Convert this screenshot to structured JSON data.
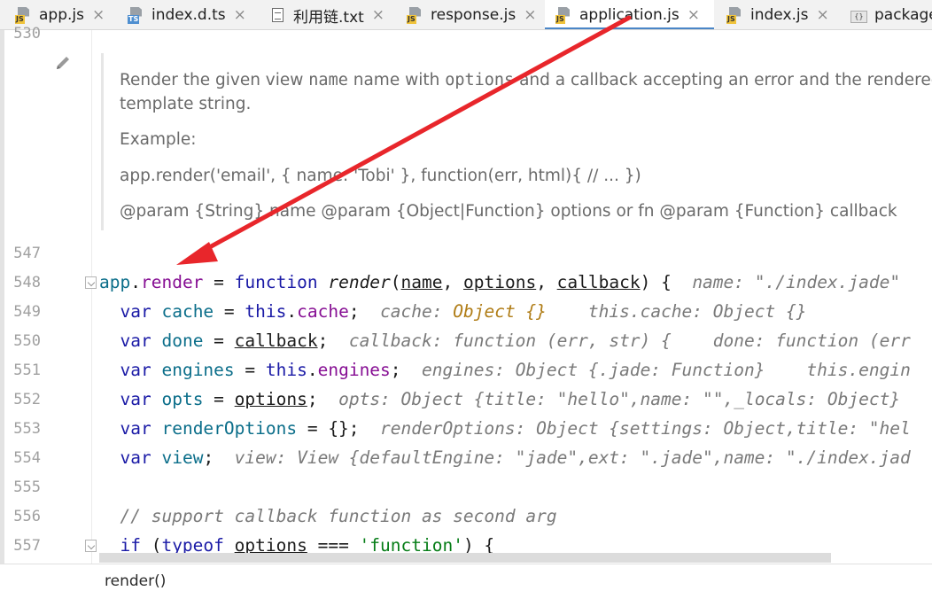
{
  "tabs": [
    {
      "label": "app.js",
      "icon": "js-file-icon",
      "type": "js",
      "active": false
    },
    {
      "label": "index.d.ts",
      "icon": "ts-file-icon",
      "type": "ts",
      "active": false
    },
    {
      "label": "利用链.txt",
      "icon": "text-file-icon",
      "type": "txt",
      "active": false
    },
    {
      "label": "response.js",
      "icon": "js-file-icon",
      "type": "js",
      "active": false
    },
    {
      "label": "application.js",
      "icon": "js-file-icon",
      "type": "js",
      "active": true
    },
    {
      "label": "index.js",
      "icon": "js-file-icon",
      "type": "js",
      "active": false
    },
    {
      "label": "package",
      "icon": "json-file-icon",
      "type": "json",
      "active": false
    }
  ],
  "tab_close_glyph": "×",
  "gutter": {
    "doc_line_number": "530",
    "line_numbers": [
      "547",
      "548",
      "549",
      "550",
      "551",
      "552",
      "553",
      "554",
      "555",
      "556",
      "557"
    ]
  },
  "doc": {
    "line1a": "Render the given view ",
    "line1_name": "name",
    "line1b": " name with ",
    "line1_options": "options",
    "line1c": " and a callback accepting an error and the rendered",
    "line2": "template string.",
    "example_label": "Example:",
    "example_code": "app.render('email', { name: 'Tobi' }, function(err, html){ // ... })",
    "params": "@param {String} name @param {Object|Function} options or fn @param {Function} callback"
  },
  "code": {
    "l548": {
      "obj": "app",
      "dot": ".",
      "prop": "render",
      "eq": " = ",
      "kw": "function",
      "sp": " ",
      "fname": "render",
      "open": "(",
      "p1": "name",
      "c1": ", ",
      "p2": "options",
      "c2": ", ",
      "p3": "callback",
      "close": ") {",
      "hint": "name: \"./index.jade\" "
    },
    "l549": {
      "kw": "var",
      "name": "cache",
      "eq": " = ",
      "this": "this",
      "dot": ".",
      "prop": "cache",
      "semi": ";",
      "hint1": "cache: ",
      "hint1_val": "Object {}",
      "hint2": "this.cache: Object {}"
    },
    "l550": {
      "kw": "var",
      "name": "done",
      "eq": " = ",
      "rhs": "callback",
      "semi": ";",
      "hint1": "callback: function (err, str) {",
      "hint2": "done: function (err"
    },
    "l551": {
      "kw": "var",
      "name": "engines",
      "eq": " = ",
      "this": "this",
      "dot": ".",
      "prop": "engines",
      "semi": ";",
      "hint1": "engines: Object {.jade: Function}",
      "hint2": "this.engin"
    },
    "l552": {
      "kw": "var",
      "name": "opts",
      "eq": " = ",
      "rhs": "options",
      "semi": ";",
      "hint1": "opts: Object {title: \"hello\",name: \"\",_locals: Object}"
    },
    "l553": {
      "kw": "var",
      "name": "renderOptions",
      "rest": " = {};",
      "hint1": "renderOptions: Object {settings: Object,title: \"hel"
    },
    "l554": {
      "kw": "var",
      "name": "view",
      "semi": ";",
      "hint1": "view: View {defaultEngine: \"jade\",ext: \".jade\",name: \"./index.jad"
    },
    "l556": {
      "comment": "// support callback function as second arg"
    },
    "l557": {
      "kw": "if",
      "open": " (",
      "kw2": "typeof",
      "sp": " ",
      "param": "options",
      "op": " === ",
      "str": "'function'",
      "close": ") {"
    }
  },
  "status": {
    "breadcrumb": "render()"
  },
  "colors": {
    "annotation_arrow": "#e8262b",
    "active_tab_underline": "#4a86c7",
    "keyword": "#1a1aa6",
    "property": "#871094"
  }
}
